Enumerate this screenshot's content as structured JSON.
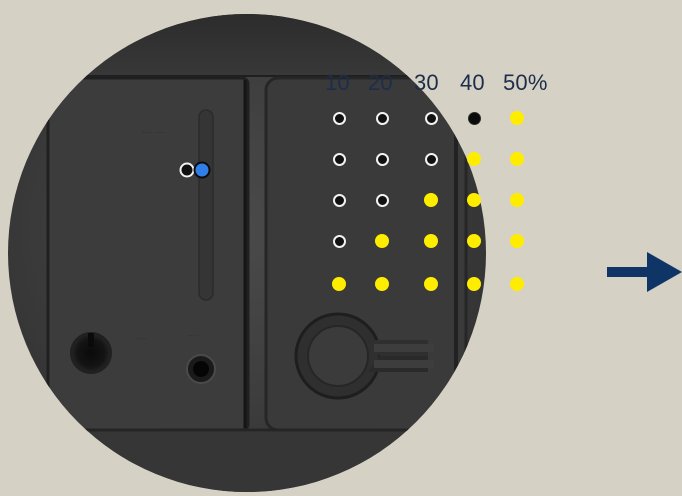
{
  "scale": {
    "labels": [
      "10",
      "20",
      "30",
      "40",
      "50%"
    ]
  },
  "indicator_grid": {
    "columns": 5,
    "rows": 5,
    "states": [
      [
        "off",
        "off",
        "off",
        "off-plain",
        "on"
      ],
      [
        "off",
        "off",
        "off",
        "on",
        "on"
      ],
      [
        "off",
        "off",
        "on",
        "on",
        "on"
      ],
      [
        "off",
        "on",
        "on",
        "on",
        "on"
      ],
      [
        "on",
        "on",
        "on",
        "on",
        "on"
      ]
    ]
  },
  "colors": {
    "background": "#d5d1c5",
    "device_body": "#3e3e3e",
    "led_on": "#ffed00",
    "led_blue": "#2f7fe6",
    "label_text": "#1d2d4a",
    "arrow": "#0f3566"
  },
  "icons": {
    "status_led": "blue-led-icon",
    "next": "right-arrow-icon"
  }
}
